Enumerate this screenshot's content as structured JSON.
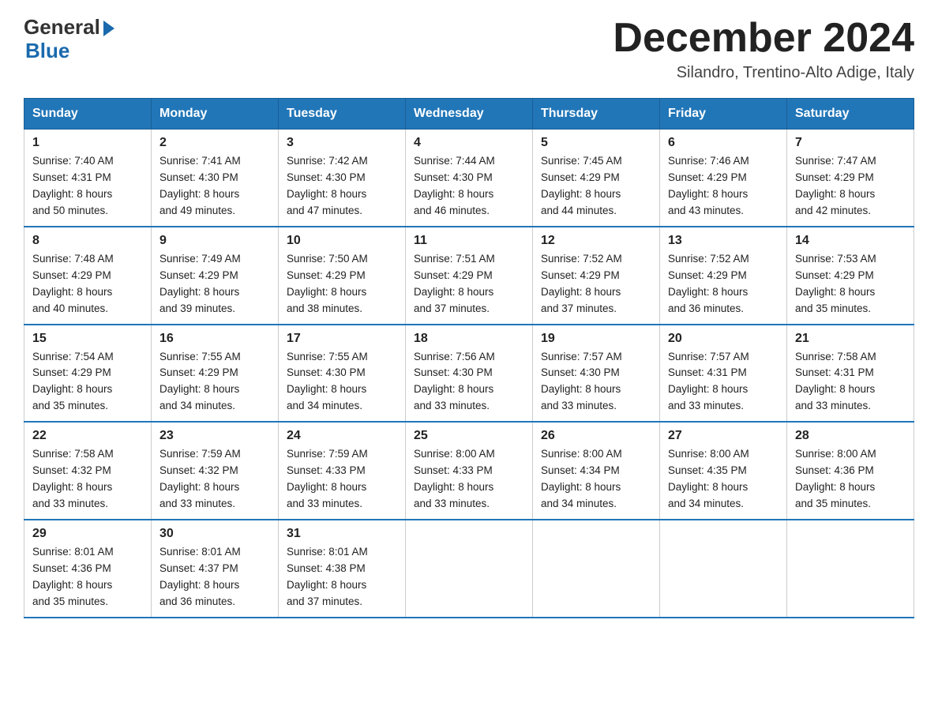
{
  "header": {
    "logo_line1": "General",
    "logo_line2": "Blue",
    "month_year": "December 2024",
    "location": "Silandro, Trentino-Alto Adige, Italy"
  },
  "days_of_week": [
    "Sunday",
    "Monday",
    "Tuesday",
    "Wednesday",
    "Thursday",
    "Friday",
    "Saturday"
  ],
  "weeks": [
    [
      {
        "day": "1",
        "sunrise": "7:40 AM",
        "sunset": "4:31 PM",
        "daylight": "8 hours and 50 minutes."
      },
      {
        "day": "2",
        "sunrise": "7:41 AM",
        "sunset": "4:30 PM",
        "daylight": "8 hours and 49 minutes."
      },
      {
        "day": "3",
        "sunrise": "7:42 AM",
        "sunset": "4:30 PM",
        "daylight": "8 hours and 47 minutes."
      },
      {
        "day": "4",
        "sunrise": "7:44 AM",
        "sunset": "4:30 PM",
        "daylight": "8 hours and 46 minutes."
      },
      {
        "day": "5",
        "sunrise": "7:45 AM",
        "sunset": "4:29 PM",
        "daylight": "8 hours and 44 minutes."
      },
      {
        "day": "6",
        "sunrise": "7:46 AM",
        "sunset": "4:29 PM",
        "daylight": "8 hours and 43 minutes."
      },
      {
        "day": "7",
        "sunrise": "7:47 AM",
        "sunset": "4:29 PM",
        "daylight": "8 hours and 42 minutes."
      }
    ],
    [
      {
        "day": "8",
        "sunrise": "7:48 AM",
        "sunset": "4:29 PM",
        "daylight": "8 hours and 40 minutes."
      },
      {
        "day": "9",
        "sunrise": "7:49 AM",
        "sunset": "4:29 PM",
        "daylight": "8 hours and 39 minutes."
      },
      {
        "day": "10",
        "sunrise": "7:50 AM",
        "sunset": "4:29 PM",
        "daylight": "8 hours and 38 minutes."
      },
      {
        "day": "11",
        "sunrise": "7:51 AM",
        "sunset": "4:29 PM",
        "daylight": "8 hours and 37 minutes."
      },
      {
        "day": "12",
        "sunrise": "7:52 AM",
        "sunset": "4:29 PM",
        "daylight": "8 hours and 37 minutes."
      },
      {
        "day": "13",
        "sunrise": "7:52 AM",
        "sunset": "4:29 PM",
        "daylight": "8 hours and 36 minutes."
      },
      {
        "day": "14",
        "sunrise": "7:53 AM",
        "sunset": "4:29 PM",
        "daylight": "8 hours and 35 minutes."
      }
    ],
    [
      {
        "day": "15",
        "sunrise": "7:54 AM",
        "sunset": "4:29 PM",
        "daylight": "8 hours and 35 minutes."
      },
      {
        "day": "16",
        "sunrise": "7:55 AM",
        "sunset": "4:29 PM",
        "daylight": "8 hours and 34 minutes."
      },
      {
        "day": "17",
        "sunrise": "7:55 AM",
        "sunset": "4:30 PM",
        "daylight": "8 hours and 34 minutes."
      },
      {
        "day": "18",
        "sunrise": "7:56 AM",
        "sunset": "4:30 PM",
        "daylight": "8 hours and 33 minutes."
      },
      {
        "day": "19",
        "sunrise": "7:57 AM",
        "sunset": "4:30 PM",
        "daylight": "8 hours and 33 minutes."
      },
      {
        "day": "20",
        "sunrise": "7:57 AM",
        "sunset": "4:31 PM",
        "daylight": "8 hours and 33 minutes."
      },
      {
        "day": "21",
        "sunrise": "7:58 AM",
        "sunset": "4:31 PM",
        "daylight": "8 hours and 33 minutes."
      }
    ],
    [
      {
        "day": "22",
        "sunrise": "7:58 AM",
        "sunset": "4:32 PM",
        "daylight": "8 hours and 33 minutes."
      },
      {
        "day": "23",
        "sunrise": "7:59 AM",
        "sunset": "4:32 PM",
        "daylight": "8 hours and 33 minutes."
      },
      {
        "day": "24",
        "sunrise": "7:59 AM",
        "sunset": "4:33 PM",
        "daylight": "8 hours and 33 minutes."
      },
      {
        "day": "25",
        "sunrise": "8:00 AM",
        "sunset": "4:33 PM",
        "daylight": "8 hours and 33 minutes."
      },
      {
        "day": "26",
        "sunrise": "8:00 AM",
        "sunset": "4:34 PM",
        "daylight": "8 hours and 34 minutes."
      },
      {
        "day": "27",
        "sunrise": "8:00 AM",
        "sunset": "4:35 PM",
        "daylight": "8 hours and 34 minutes."
      },
      {
        "day": "28",
        "sunrise": "8:00 AM",
        "sunset": "4:36 PM",
        "daylight": "8 hours and 35 minutes."
      }
    ],
    [
      {
        "day": "29",
        "sunrise": "8:01 AM",
        "sunset": "4:36 PM",
        "daylight": "8 hours and 35 minutes."
      },
      {
        "day": "30",
        "sunrise": "8:01 AM",
        "sunset": "4:37 PM",
        "daylight": "8 hours and 36 minutes."
      },
      {
        "day": "31",
        "sunrise": "8:01 AM",
        "sunset": "4:38 PM",
        "daylight": "8 hours and 37 minutes."
      },
      null,
      null,
      null,
      null
    ]
  ],
  "labels": {
    "sunrise": "Sunrise:",
    "sunset": "Sunset:",
    "daylight": "Daylight:"
  }
}
